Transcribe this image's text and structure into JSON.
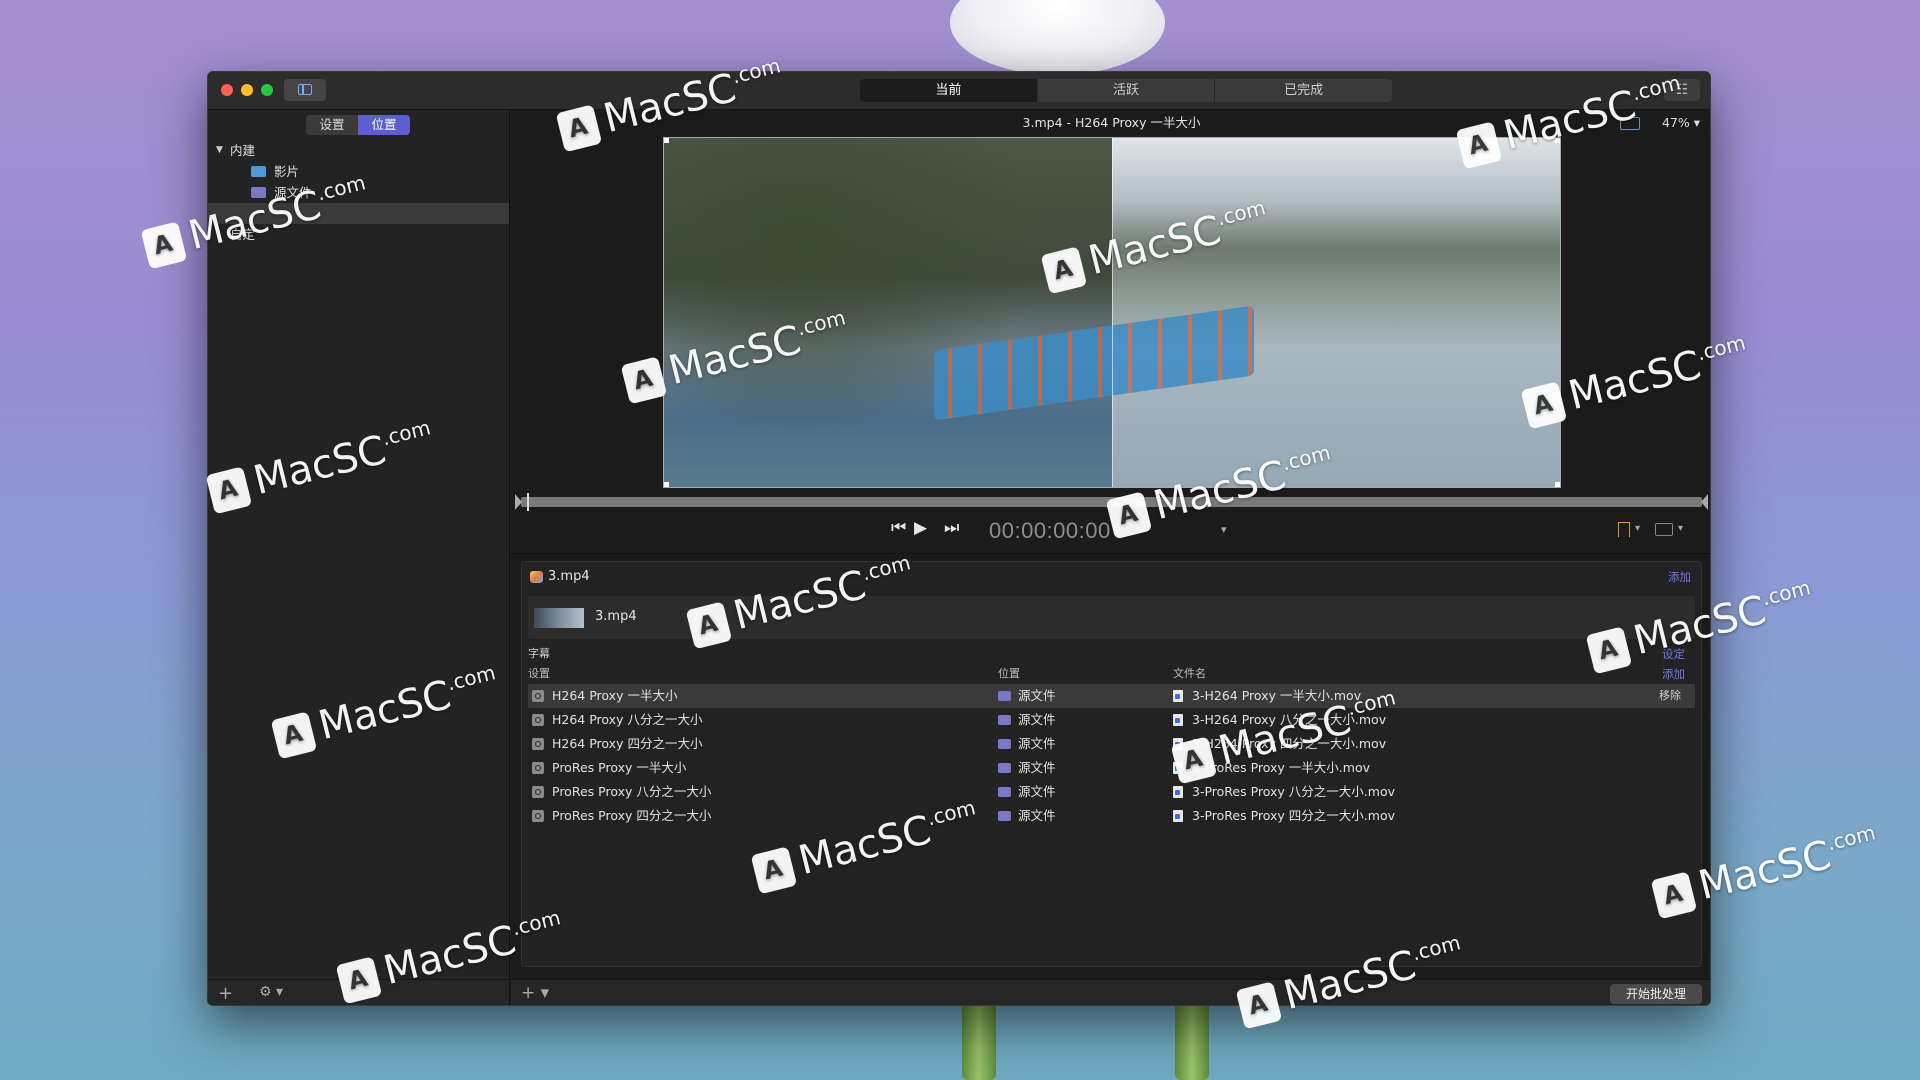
{
  "titlebar": {
    "tabs": [
      {
        "label": "当前",
        "active": true
      },
      {
        "label": "活跃",
        "active": false
      },
      {
        "label": "已完成",
        "active": false
      }
    ]
  },
  "sidebar": {
    "segments": [
      {
        "label": "设置",
        "active": false
      },
      {
        "label": "位置",
        "active": true
      }
    ],
    "tree": {
      "group_builtin": "内建",
      "items": [
        {
          "label": "影片",
          "icon": "blue-folder-icon"
        },
        {
          "label": "源文件",
          "icon": "purple-folder-icon"
        },
        {
          "label": "",
          "icon": ""
        }
      ],
      "group_custom": "自定"
    }
  },
  "viewer": {
    "header": "3.mp4 - H264 Proxy 一半大小",
    "zoom": "47%",
    "timecode": "00:00:00:00"
  },
  "batch": {
    "source_name": "3.mp4",
    "add_label": "添加",
    "job_name": "3.mp4",
    "subtitles_label": "字幕",
    "subtitles_action": "设定",
    "columns": {
      "setting": "设置",
      "location": "位置",
      "filename": "文件名",
      "add": "添加"
    },
    "remove_label": "移除",
    "rows": [
      {
        "setting": "H264 Proxy 一半大小",
        "location": "源文件",
        "filename": "3-H264 Proxy 一半大小.mov",
        "selected": true
      },
      {
        "setting": "H264 Proxy 八分之一大小",
        "location": "源文件",
        "filename": "3-H264 Proxy 八分之一大小.mov",
        "selected": false
      },
      {
        "setting": "H264 Proxy 四分之一大小",
        "location": "源文件",
        "filename": "3-H264 Proxy 四分之一大小.mov",
        "selected": false
      },
      {
        "setting": "ProRes Proxy 一半大小",
        "location": "源文件",
        "filename": "3-ProRes Proxy 一半大小.mov",
        "selected": false
      },
      {
        "setting": "ProRes Proxy 八分之一大小",
        "location": "源文件",
        "filename": "3-ProRes Proxy 八分之一大小.mov",
        "selected": false
      },
      {
        "setting": "ProRes Proxy 四分之一大小",
        "location": "源文件",
        "filename": "3-ProRes Proxy 四分之一大小.mov",
        "selected": false
      }
    ]
  },
  "footer": {
    "start_button": "开始批处理"
  },
  "watermark": {
    "text": "MacSC",
    "suffix": ".com"
  },
  "colors": {
    "accent": "#5b5fcf",
    "link": "#6f78e8",
    "bookmark": "#e3902e"
  }
}
